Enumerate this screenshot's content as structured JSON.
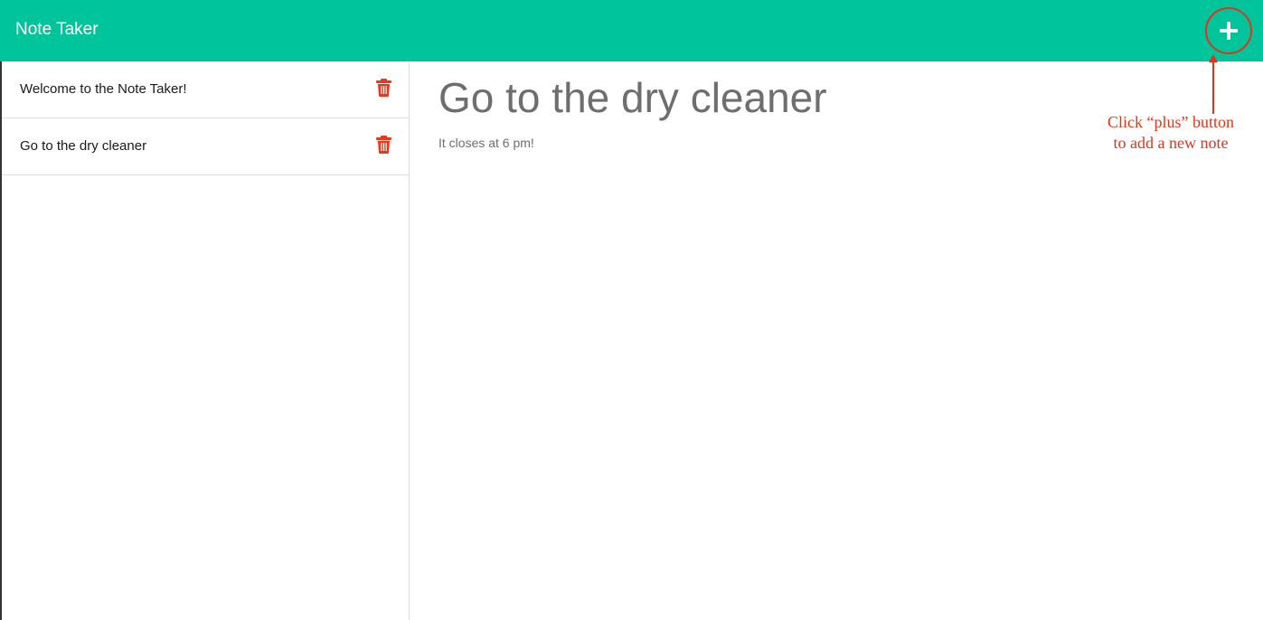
{
  "navbar": {
    "brand": "Note Taker",
    "add_button_icon": "plus-icon",
    "background_color": "#00c49c"
  },
  "annotation": {
    "text": "Click “plus” button to add a new note",
    "color": "#e0351a"
  },
  "notes": [
    {
      "title": "Welcome to the Note Taker!",
      "delete_icon": "trash-icon"
    },
    {
      "title": "Go to the dry cleaner",
      "delete_icon": "trash-icon"
    }
  ],
  "active_note": {
    "title": "Go to the dry cleaner",
    "text": "It closes at 6 pm!"
  }
}
